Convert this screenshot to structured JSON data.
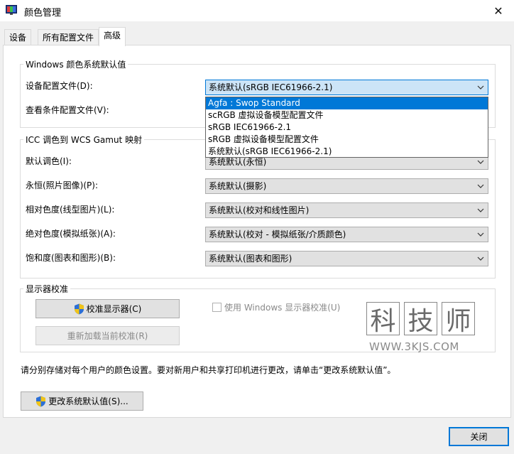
{
  "window": {
    "title": "颜色管理",
    "close_glyph": "✕"
  },
  "tabs": [
    {
      "label": "设备"
    },
    {
      "label": "所有配置文件"
    },
    {
      "label": "高级"
    }
  ],
  "windows_defaults": {
    "title": "Windows 颜色系统默认值",
    "device_profile_label": "设备配置文件(D):",
    "device_profile_value": "系统默认(sRGB IEC61966-2.1)",
    "viewing_conditions_label": "查看条件配置文件(V):",
    "dropdown_options": [
      "Agfa : Swop Standard",
      "scRGB 虚拟设备模型配置文件",
      "sRGB IEC61966-2.1",
      "sRGB 虚拟设备模型配置文件",
      "系统默认(sRGB IEC61966-2.1)"
    ]
  },
  "icc_mapping": {
    "title": "ICC 调色到 WCS Gamut 映射",
    "rows": [
      {
        "label": "默认调色(I):",
        "value": "系统默认(永恒)"
      },
      {
        "label": "永恒(照片图像)(P):",
        "value": "系统默认(摄影)"
      },
      {
        "label": "相对色度(线型图片)(L):",
        "value": "系统默认(校对和线性图片)"
      },
      {
        "label": "绝对色度(模拟纸张)(A):",
        "value": "系统默认(校对 - 模拟纸张/介质颜色)"
      },
      {
        "label": "饱和度(图表和图形)(B):",
        "value": "系统默认(图表和图形)"
      }
    ]
  },
  "calibration": {
    "title": "显示器校准",
    "calibrate_button": "校准显示器(C)",
    "reload_button": "重新加载当前校准(R)",
    "use_windows_calibration": "使用 Windows 显示器校准(U)"
  },
  "watermark": {
    "chars": [
      "科",
      "技",
      "师"
    ],
    "url": "WWW.3KJS.COM"
  },
  "info_text": "请分别存储对每个用户的颜色设置。要对新用户和共享打印机进行更改，请单击“更改系统默认值”。",
  "change_defaults_button": "更改系统默认值(S)...",
  "close_button": "关闭",
  "colors": {
    "accent": "#0078d7",
    "panel": "#f0f0f0",
    "button": "#e1e1e1"
  }
}
